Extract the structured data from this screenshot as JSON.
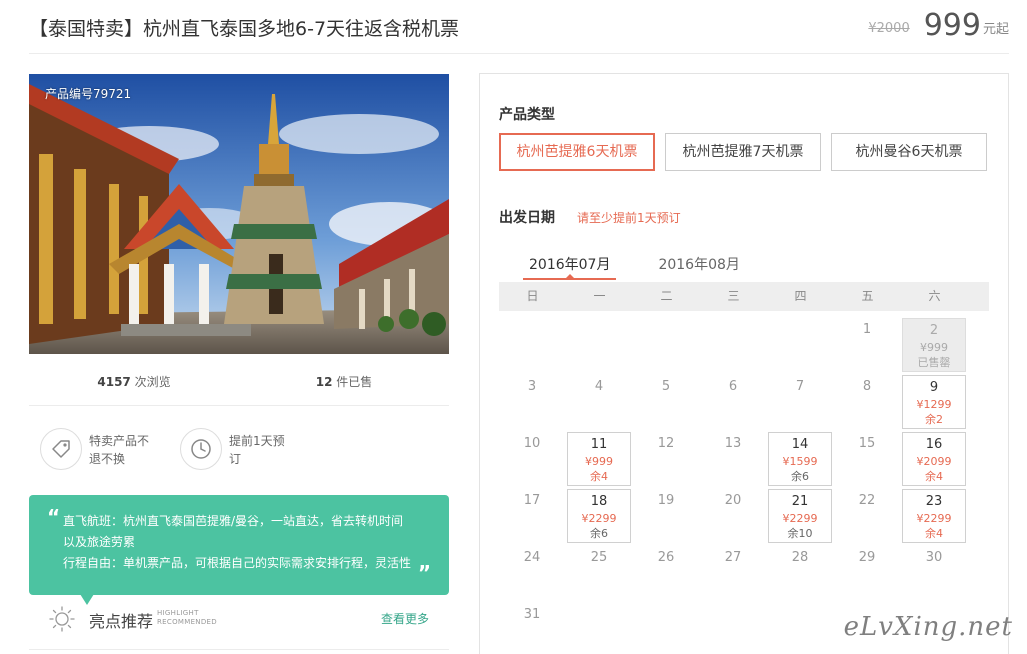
{
  "header": {
    "title": "【泰国特卖】杭州直飞泰国多地6-7天往返含税机票",
    "old_price": "¥2000",
    "price": "999",
    "price_unit": "元起"
  },
  "photo": {
    "product_id": "产品编号79721"
  },
  "stats": {
    "views_count": "4157",
    "views_label": "次浏览",
    "sold_count": "12",
    "sold_label": "件已售"
  },
  "features": [
    {
      "text": "特卖产品不退不换",
      "icon": "tag-icon"
    },
    {
      "text": "提前1天预订",
      "icon": "clock-icon"
    }
  ],
  "quote": {
    "open": "“",
    "close": "”",
    "line1": "直飞航班：杭州直飞泰国芭提雅/曼谷，一站直达，省去转机时间",
    "line2": "以及旅途劳累",
    "line3": "行程自由：单机票产品，可根据自己的实际需求安排行程，灵活性"
  },
  "highlight": {
    "title": "亮点推荐",
    "en1": "HIGHLIGHT",
    "en2": "RECOMMENDED",
    "more": "查看更多"
  },
  "booking": {
    "type_label": "产品类型",
    "types": [
      "杭州芭提雅6天机票",
      "杭州芭提雅7天机票",
      "杭州曼谷6天机票"
    ],
    "active_type": 0,
    "date_label": "出发日期",
    "date_note": "请至少提前1天预订",
    "months": [
      "2016年07月",
      "2016年08月"
    ],
    "active_month": 0,
    "weekdays": [
      "日",
      "一",
      "二",
      "三",
      "四",
      "五",
      "六"
    ],
    "days": [
      {
        "day": "1",
        "col": 5,
        "row": 0
      },
      {
        "day": "2",
        "col": 6,
        "row": 0,
        "price": "¥999",
        "left": "已售罄",
        "status": "soldout"
      },
      {
        "day": "3",
        "col": 0,
        "row": 1
      },
      {
        "day": "4",
        "col": 1,
        "row": 1
      },
      {
        "day": "5",
        "col": 2,
        "row": 1
      },
      {
        "day": "6",
        "col": 3,
        "row": 1
      },
      {
        "day": "7",
        "col": 4,
        "row": 1
      },
      {
        "day": "8",
        "col": 5,
        "row": 1
      },
      {
        "day": "9",
        "col": 6,
        "row": 1,
        "price": "¥1299",
        "left": "余2",
        "status": "red"
      },
      {
        "day": "10",
        "col": 0,
        "row": 2
      },
      {
        "day": "11",
        "col": 1,
        "row": 2,
        "price": "¥999",
        "left": "余4",
        "status": "red"
      },
      {
        "day": "12",
        "col": 2,
        "row": 2
      },
      {
        "day": "13",
        "col": 3,
        "row": 2
      },
      {
        "day": "14",
        "col": 4,
        "row": 2,
        "price": "¥1599",
        "left": "余6",
        "status": "grey"
      },
      {
        "day": "15",
        "col": 5,
        "row": 2
      },
      {
        "day": "16",
        "col": 6,
        "row": 2,
        "price": "¥2099",
        "left": "余4",
        "status": "red"
      },
      {
        "day": "17",
        "col": 0,
        "row": 3
      },
      {
        "day": "18",
        "col": 1,
        "row": 3,
        "price": "¥2299",
        "left": "余6",
        "status": "grey"
      },
      {
        "day": "19",
        "col": 2,
        "row": 3
      },
      {
        "day": "20",
        "col": 3,
        "row": 3
      },
      {
        "day": "21",
        "col": 4,
        "row": 3,
        "price": "¥2299",
        "left": "余10",
        "status": "grey"
      },
      {
        "day": "22",
        "col": 5,
        "row": 3
      },
      {
        "day": "23",
        "col": 6,
        "row": 3,
        "price": "¥2299",
        "left": "余4",
        "status": "red"
      },
      {
        "day": "24",
        "col": 0,
        "row": 4
      },
      {
        "day": "25",
        "col": 1,
        "row": 4
      },
      {
        "day": "26",
        "col": 2,
        "row": 4
      },
      {
        "day": "27",
        "col": 3,
        "row": 4
      },
      {
        "day": "28",
        "col": 4,
        "row": 4
      },
      {
        "day": "29",
        "col": 5,
        "row": 4
      },
      {
        "day": "30",
        "col": 6,
        "row": 4
      },
      {
        "day": "31",
        "col": 0,
        "row": 5
      }
    ]
  },
  "watermark": "eLvXing.net",
  "colors": {
    "accent": "#e66a52",
    "teal": "#4cc3a1",
    "link": "#36a68a"
  }
}
